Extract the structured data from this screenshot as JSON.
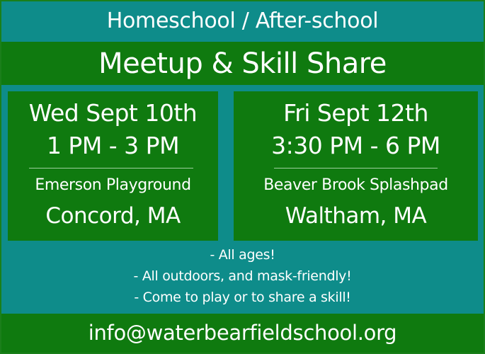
{
  "header": {
    "subtitle": "Homeschool / After-school",
    "title": "Meetup & Skill Share"
  },
  "events": [
    {
      "date": "Wed Sept 10th",
      "time": "1 PM - 3 PM",
      "venue": "Emerson Playground",
      "city": "Concord, MA"
    },
    {
      "date": "Fri Sept 12th",
      "time": "3:30 PM - 6 PM",
      "venue": "Beaver Brook Splashpad",
      "city": "Waltham, MA"
    }
  ],
  "notes": [
    "- All ages!",
    "- All outdoors, and mask-friendly!",
    "- Come to play or to share a skill!"
  ],
  "footer": {
    "email": "info@waterbearfieldschool.org"
  },
  "colors": {
    "green": "#0f7a0f",
    "teal": "#0e8c8a",
    "text": "#ffffff"
  }
}
